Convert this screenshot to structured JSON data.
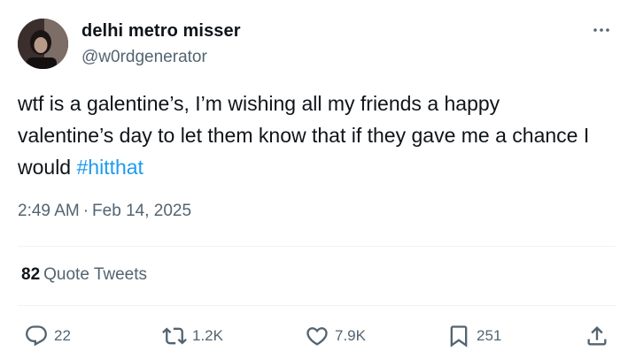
{
  "author": {
    "display_name": "delhi metro misser",
    "handle": "@w0rdgenerator"
  },
  "tweet": {
    "text_before": "wtf is a galentine’s, I’m wishing all my friends a happy valentine’s day to let them know that if they gave me a chance I would ",
    "hashtag": "#hitthat",
    "time": "2:49 AM",
    "separator": "·",
    "date": "Feb 14, 2025"
  },
  "quote_tweets": {
    "count": "82",
    "label": "Quote Tweets"
  },
  "actions": {
    "replies": "22",
    "retweets": "1.2K",
    "likes": "7.9K",
    "bookmarks": "251"
  },
  "icons": {
    "more": "more-horizontal-icon",
    "reply": "reply-icon",
    "retweet": "retweet-icon",
    "like": "heart-icon",
    "bookmark": "bookmark-icon",
    "share": "share-icon"
  },
  "colors": {
    "text": "#0f1419",
    "secondary": "#536471",
    "link": "#1d9bf0",
    "divider": "#eff3f4"
  }
}
